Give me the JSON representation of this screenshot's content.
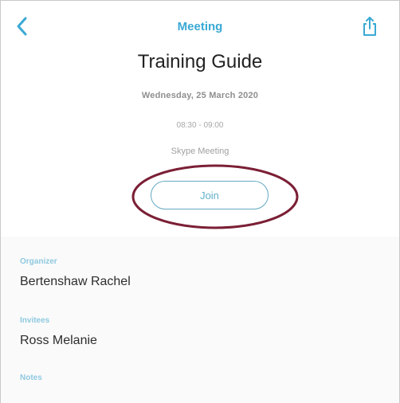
{
  "nav": {
    "title": "Meeting",
    "back_icon": "chevron-left-icon",
    "share_icon": "share-icon"
  },
  "event": {
    "title": "Training Guide",
    "date": "Wednesday, 25 March 2020",
    "time": "08:30 - 09:00",
    "location": "Skype Meeting",
    "join_label": "Join"
  },
  "details": {
    "organizer_label": "Organizer",
    "organizer_value": "Bertenshaw Rachel",
    "invitees_label": "Invitees",
    "invitees_value": "Ross Melanie",
    "notes_label": "Notes"
  },
  "colors": {
    "accent": "#3aa9d4",
    "join_border": "#63a9c2",
    "annotation_ring": "#7b1f35"
  }
}
